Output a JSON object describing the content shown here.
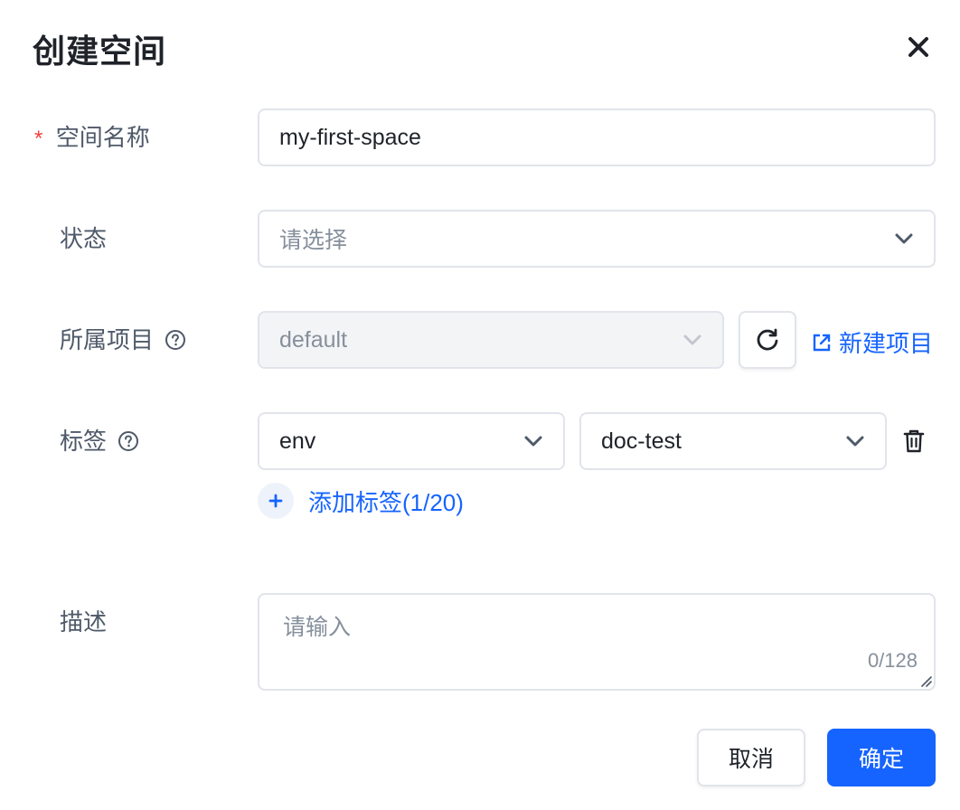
{
  "dialog": {
    "title": "创建空间"
  },
  "form": {
    "name": {
      "required_mark": "*",
      "label": "空间名称",
      "value": "my-first-space"
    },
    "status": {
      "label": "状态",
      "placeholder": "请选择"
    },
    "project": {
      "label": "所属项目",
      "value": "default",
      "disabled": true,
      "new_project_label": "新建项目"
    },
    "tags": {
      "label": "标签",
      "items": [
        {
          "key": "env",
          "value": "doc-test"
        }
      ],
      "add_label": "添加标签(1/20)"
    },
    "description": {
      "label": "描述",
      "placeholder": "请输入",
      "counter": "0/128"
    }
  },
  "footer": {
    "cancel_label": "取消",
    "confirm_label": "确定"
  },
  "colors": {
    "primary": "#1664ff",
    "required": "#f53f3f",
    "border": "#e1e4ea"
  },
  "icons": [
    "close-icon",
    "help-icon",
    "chevron-down-icon",
    "refresh-icon",
    "external-link-icon",
    "trash-icon",
    "plus-icon",
    "resize-handle-icon"
  ]
}
